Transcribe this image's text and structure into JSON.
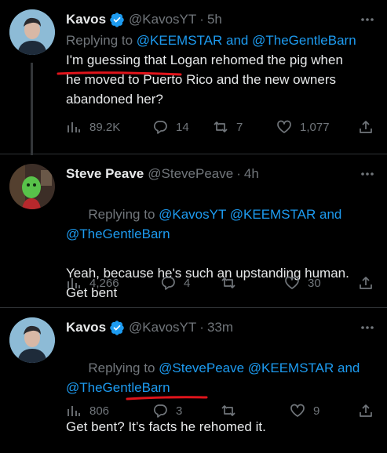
{
  "tweets": [
    {
      "name": "Kavos",
      "handle": "@KavosYT",
      "time": "5h",
      "replying_prefix": "Replying to ",
      "replying_links": "@KEEMSTAR and @TheGentleBarn",
      "text": "I'm guessing that Logan rehomed the pig when\nhe moved to Puerto Rico and the new owners\nabandoned her?",
      "views": "89.2K",
      "replies": "14",
      "retweets": "7",
      "likes": "1,077",
      "verified": true
    },
    {
      "name": "Steve Peave",
      "handle": "@StevePeave",
      "time": "4h",
      "replying_prefix": "Replying to ",
      "replying_links": "@KavosYT @KEEMSTAR and\n@TheGentleBarn",
      "text": "Yeah, because he's such an upstanding human.\nGet bent",
      "views": "4,266",
      "replies": "4",
      "retweets": "",
      "likes": "30",
      "verified": false
    },
    {
      "name": "Kavos",
      "handle": "@KavosYT",
      "time": "33m",
      "replying_prefix": "Replying to ",
      "replying_links": "@StevePeave @KEEMSTAR and\n@TheGentleBarn",
      "text": "Get bent? It’s facts he rehomed it.",
      "views": "806",
      "replies": "3",
      "retweets": "",
      "likes": "9",
      "verified": true
    }
  ],
  "colors": {
    "background": "#000000",
    "text": "#e7e9ea",
    "secondary": "#71767b",
    "link": "#1d9bf0",
    "verified": "#1d9bf0",
    "annotation": "#e0141b"
  },
  "icons": [
    "verified-icon",
    "more-icon",
    "views-icon",
    "reply-icon",
    "retweet-icon",
    "like-icon",
    "share-icon"
  ]
}
